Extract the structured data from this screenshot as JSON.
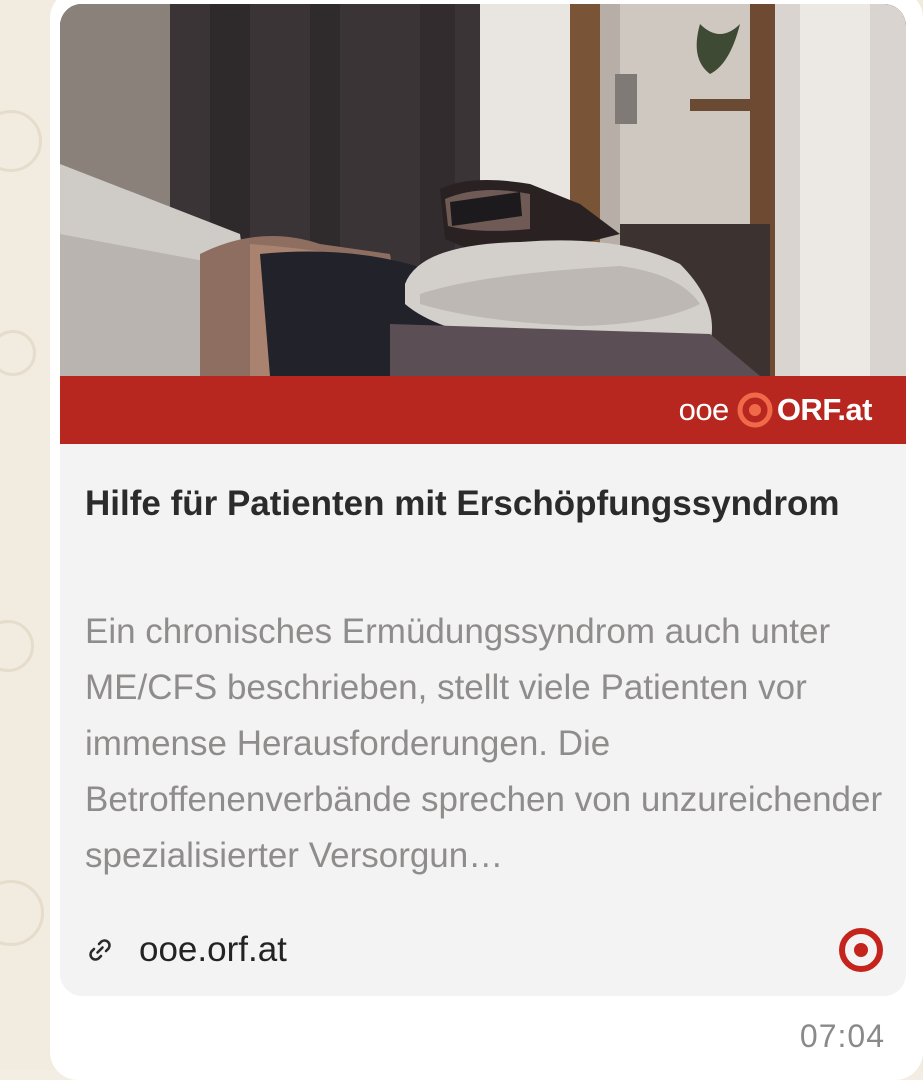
{
  "preview": {
    "image_alt": "Person resting in bed with a sleep mask",
    "brand_prefix": "ooe",
    "brand_name": "ORF.at",
    "title": "Hilfe für Patienten mit Erschöpfungssyndrom",
    "description": "Ein chronisches Ermüdungssyndrom auch unter ME/CFS beschrieben, stellt viele Patienten vor immense Herausforderungen. Die Betroffenenverbände sprechen von unzureichender spezialisierter Versorgun…",
    "domain": "ooe.orf.at",
    "accent_color": "#b8271f"
  },
  "message": {
    "time": "07:04"
  },
  "icons": {
    "link": "link-icon",
    "site": "orf-logo-icon"
  }
}
